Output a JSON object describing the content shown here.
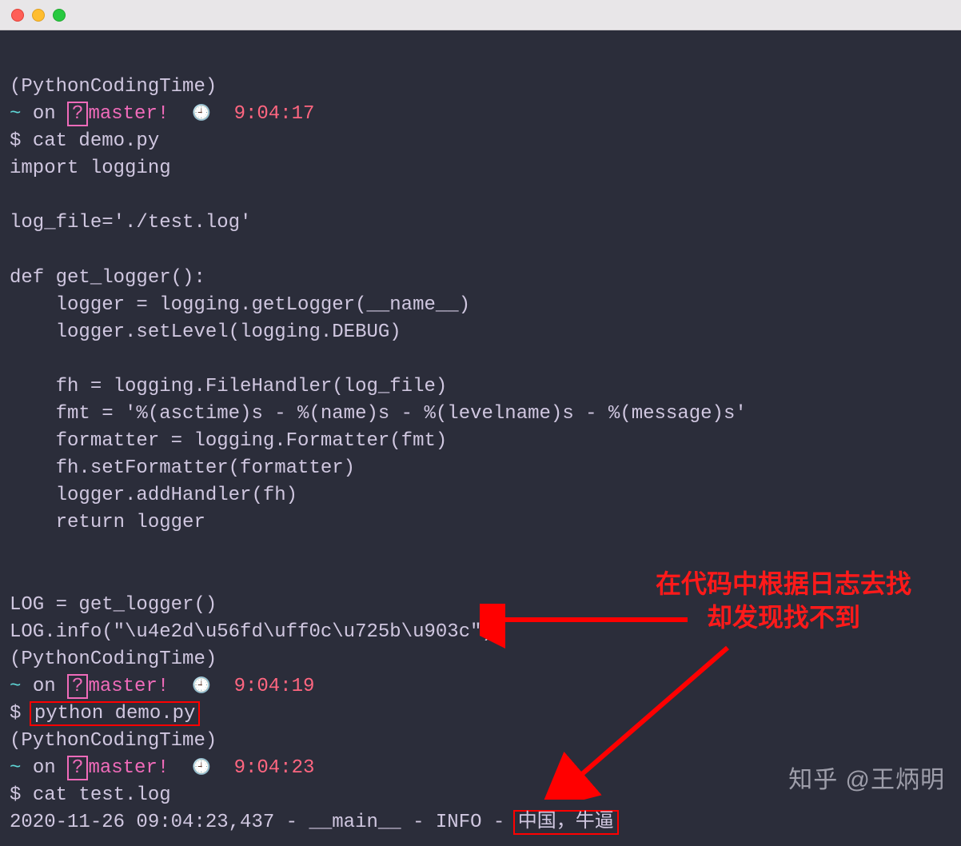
{
  "prompt": {
    "context": "(PythonCodingTime)",
    "tilde": "~",
    "on": "on",
    "branch_icon": "?",
    "branch": "master",
    "bang": "!",
    "clock": "🕘",
    "dollar": "$"
  },
  "times": {
    "t1": "9:04:17",
    "t2": "9:04:19",
    "t3": "9:04:23"
  },
  "cmds": {
    "cat_demo": "cat demo.py",
    "python_demo": "python demo.py",
    "cat_test": "cat test.log"
  },
  "code": {
    "l1": "import logging",
    "l2": "",
    "l3": "log_file='./test.log'",
    "l4": "",
    "l5": "def get_logger():",
    "l6": "    logger = logging.getLogger(__name__)",
    "l7": "    logger.setLevel(logging.DEBUG)",
    "l8": "",
    "l9": "    fh = logging.FileHandler(log_file)",
    "l10": "    fmt = '%(asctime)s - %(name)s - %(levelname)s - %(message)s'",
    "l11": "    formatter = logging.Formatter(fmt)",
    "l12": "    fh.setFormatter(formatter)",
    "l13": "    logger.addHandler(fh)",
    "l14": "    return logger",
    "l15": "",
    "l16": "",
    "l17": "LOG = get_logger()",
    "l18": "LOG.info(\"\\u4e2d\\u56fd\\uff0c\\u725b\\u903c\")"
  },
  "log_output": {
    "prefix": "2020-11-26 09:04:23,437 - __main__ - INFO - ",
    "message": "中国，牛逼"
  },
  "annotation": {
    "line1": "在代码中根据日志去找",
    "line2": "却发现找不到"
  },
  "watermark": "知乎 @王炳明"
}
